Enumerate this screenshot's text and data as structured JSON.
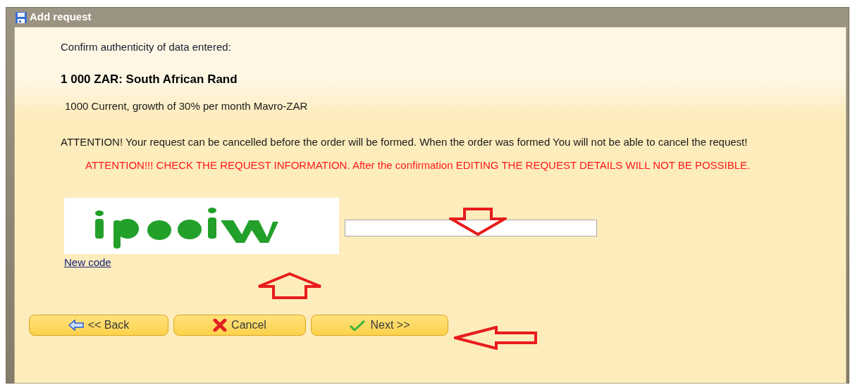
{
  "window": {
    "title": "Add request"
  },
  "intro": "Confirm authenticity of data entered:",
  "heading": "1 000 ZAR: South African Rand",
  "description": "1000 Current, growth of 30% per month Mavro-ZAR",
  "attention": "ATTENTION! Your request can be cancelled before the order will be formed. When the order was formed You will not be able to cancel the request!",
  "warning": "ATTENTION!!! CHECK THE REQUEST INFORMATION. After the confirmation EDITING THE REQUEST DETAILS WILL NOT BE POSSIBLE.",
  "captcha": {
    "kind": "picture",
    "link": "New code"
  },
  "buttons": [
    {
      "kind": "back",
      "label": "<< Back"
    },
    {
      "kind": "cancel",
      "label": "Cancel"
    },
    {
      "kind": "next",
      "label": "Next >>"
    }
  ],
  "annotations": [
    {
      "kind": "down"
    },
    {
      "kind": "up"
    },
    {
      "kind": "left"
    }
  ]
}
